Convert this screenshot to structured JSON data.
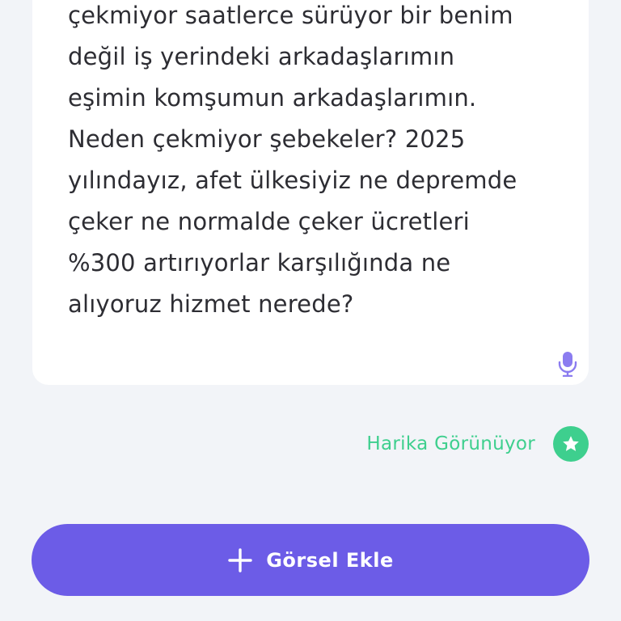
{
  "complaint": {
    "text": "çekmiyor saatlerce sürüyor bir benim\ndeğil iş yerindeki arkadaşlarımın\neşimin komşumun arkadaşlarımın.\nNeden çekmiyor şebekeler? 2025\nyılındayız, afet ülkesiyiz ne depremde\nçeker ne normalde çeker ücretleri\n%300 artırıyorlar karşılığında ne\nalıyoruz hizmet nerede?"
  },
  "icons": {
    "microphone": "microphone-icon",
    "star": "star-icon",
    "plus": "plus-icon"
  },
  "status": {
    "label": "Harika Görünüyor"
  },
  "actions": {
    "add_image_label": "Görsel Ekle"
  },
  "colors": {
    "accent": "#6c5ce7",
    "success": "#3ecf8e",
    "background": "#f2f4f8",
    "text": "#2d2d33",
    "mic": "#8b7cf0"
  }
}
